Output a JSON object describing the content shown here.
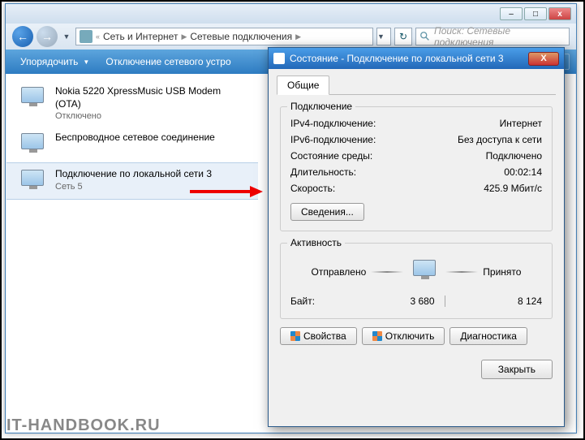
{
  "window_controls": {
    "min": "–",
    "max": "□",
    "close": "x"
  },
  "breadcrumb": {
    "a": "Сеть и Интернет",
    "b": "Сетевые подключения"
  },
  "search": {
    "placeholder": "Поиск: Сетевые подключения"
  },
  "toolbar": {
    "organize": "Упорядочить",
    "disable": "Отключение сетевого устро"
  },
  "netitems": [
    {
      "name": "Nokia 5220 XpressMusic USB Modem (OTA)",
      "sub": "Отключено"
    },
    {
      "name": "Беспроводное сетевое соединение",
      "sub": ""
    },
    {
      "name": "Подключение по локальной сети 3",
      "sub": "Сеть 5"
    }
  ],
  "dialog": {
    "title": "Состояние - Подключение по локальной сети 3",
    "tab": "Общие",
    "group_conn": "Подключение",
    "rows": {
      "ipv4_l": "IPv4-подключение:",
      "ipv4_v": "Интернет",
      "ipv6_l": "IPv6-подключение:",
      "ipv6_v": "Без доступа к сети",
      "media_l": "Состояние среды:",
      "media_v": "Подключено",
      "dur_l": "Длительность:",
      "dur_v": "00:02:14",
      "speed_l": "Скорость:",
      "speed_v": "425.9 Мбит/с"
    },
    "details_btn": "Сведения...",
    "group_act": "Активность",
    "sent": "Отправлено",
    "recv": "Принято",
    "bytes_l": "Байт:",
    "bytes_sent": "3 680",
    "bytes_recv": "8 124",
    "props": "Свойства",
    "disable": "Отключить",
    "diag": "Диагностика",
    "close": "Закрыть"
  },
  "watermark": "IT-HANDBOOK.RU"
}
